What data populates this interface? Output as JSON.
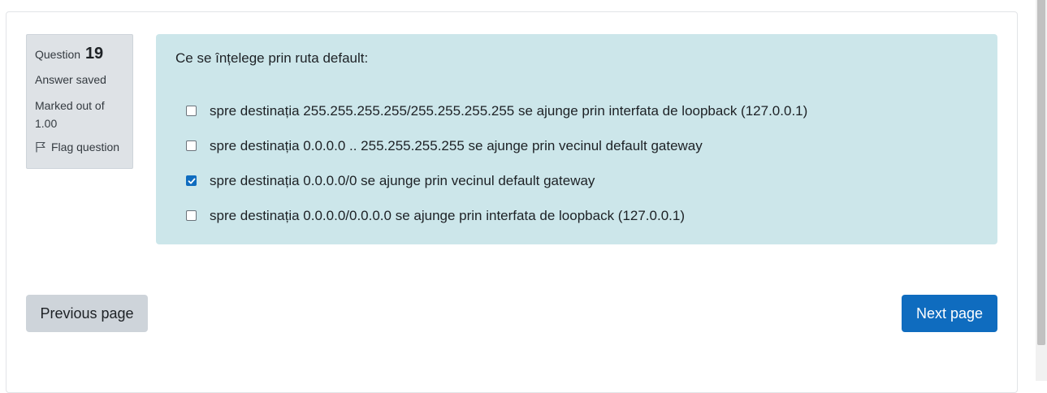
{
  "question_info": {
    "label": "Question",
    "number": "19",
    "state": "Answer saved",
    "grade": "Marked out of 1.00",
    "flag_label": "Flag question"
  },
  "question": {
    "text": "Ce se înțelege prin ruta default:",
    "answers": [
      {
        "label": "spre destinația 255.255.255.255/255.255.255.255 se ajunge prin interfata de loopback (127.0.0.1)",
        "checked": false
      },
      {
        "label": "spre destinația 0.0.0.0 .. 255.255.255.255 se ajunge prin vecinul default gateway",
        "checked": false
      },
      {
        "label": "spre destinația 0.0.0.0/0 se ajunge prin vecinul default gateway",
        "checked": true
      },
      {
        "label": "spre destinația 0.0.0.0/0.0.0.0 se ajunge prin interfata de loopback (127.0.0.1)",
        "checked": false
      }
    ]
  },
  "navigation": {
    "previous_label": "Previous page",
    "next_label": "Next page"
  },
  "colors": {
    "accent": "#0f6cbf",
    "formulation_bg": "#cce6ea",
    "info_bg": "#dee2e6"
  }
}
